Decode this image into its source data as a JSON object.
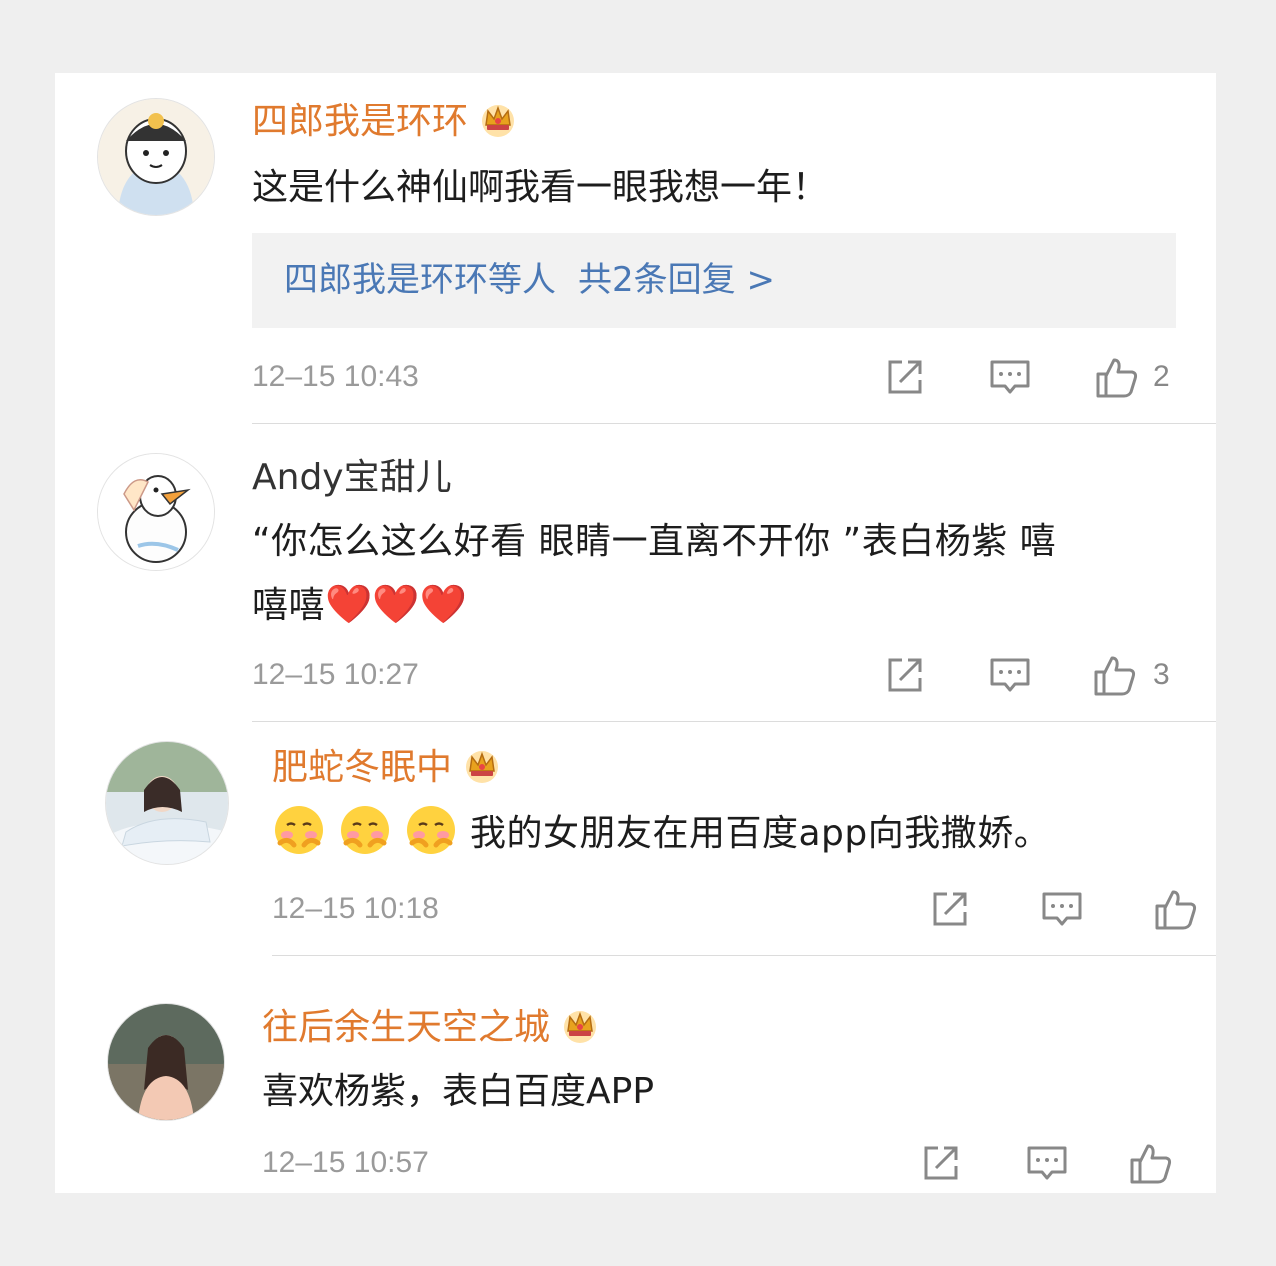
{
  "comments": [
    {
      "username": "四郎我是环环",
      "vip": true,
      "text": "这是什么神仙啊我看一眼我想一年！",
      "replies": {
        "label": "四郎我是环环等人",
        "count": "共2条回复 >"
      },
      "time": "12–15 10:43",
      "likes": "2"
    },
    {
      "username": "Andy宝甜儿",
      "vip": false,
      "text_parts": [
        "“你怎么这么好看 眼睛一直离不开你 ”表白杨紫 嘻",
        "嘻嘻",
        "❤️❤️❤️"
      ],
      "time": "12–15 10:27",
      "likes": "3"
    },
    {
      "username": "肥蛇冬眠中",
      "vip": true,
      "text": "我的女朋友在用百度app向我撒娇。",
      "time": "12–15 10:18",
      "likes": ""
    },
    {
      "username": "往后余生天空之城",
      "vip": true,
      "text": "喜欢杨紫，表白百度APP",
      "time": "12–15 10:57",
      "likes": ""
    }
  ],
  "icons": {
    "share": "share-icon",
    "comment": "comment-icon",
    "like": "thumbs-up-icon",
    "crown": "vip-crown-icon",
    "emoji": "blush-emoji-icon"
  },
  "colors": {
    "vip_name": "#e07a2e",
    "reply_link": "#4a78b5",
    "meta_gray": "#9a9a9a",
    "reply_bg": "#f2f2f2",
    "heart": "#e3242b"
  }
}
